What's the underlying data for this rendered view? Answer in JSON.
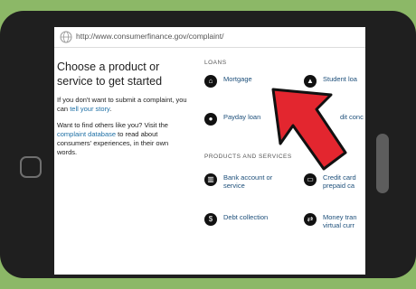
{
  "browser": {
    "url": "http://www.consumerfinance.gov/complaint/"
  },
  "intro": {
    "heading_line1": "Choose a product or",
    "heading_line2": "service to get started",
    "p1_before": "If you don't want to submit a complaint, you",
    "p1_can": "can ",
    "p1_link": "tell your story",
    "p1_after": ".",
    "p2_line1": "Want to find others like you? Visit the",
    "p2_link": "complaint database",
    "p2_after": " to read about",
    "p2_line3": "consumers' experiences, in their own",
    "p2_line4": "words."
  },
  "sections": {
    "loans_label": "LOANS",
    "products_label": "PRODUCTS AND SERVICES"
  },
  "items": {
    "mortgage": "Mortgage",
    "student_loan": "Student loa",
    "payday_loan": "Payday loan",
    "credit_consumer": "dit conc",
    "bank_line1": "Bank account or",
    "bank_line2": "service",
    "credit_card_line1": "Credit card",
    "credit_card_line2": "prepaid ca",
    "debt_collection": "Debt collection",
    "money_transfer_line1": "Money tran",
    "money_transfer_line2": "virtual curr"
  },
  "icons": {
    "mortgage": "house-icon",
    "student_loan": "graduation-cap-icon",
    "payday_loan": "coins-icon",
    "bank": "bank-icon",
    "credit_card": "credit-card-icon",
    "debt_collection": "money-icon",
    "money_transfer": "transfer-icon"
  },
  "colors": {
    "background": "#8cb867",
    "arrow": "#e3262f",
    "link": "#1d6fa5"
  }
}
